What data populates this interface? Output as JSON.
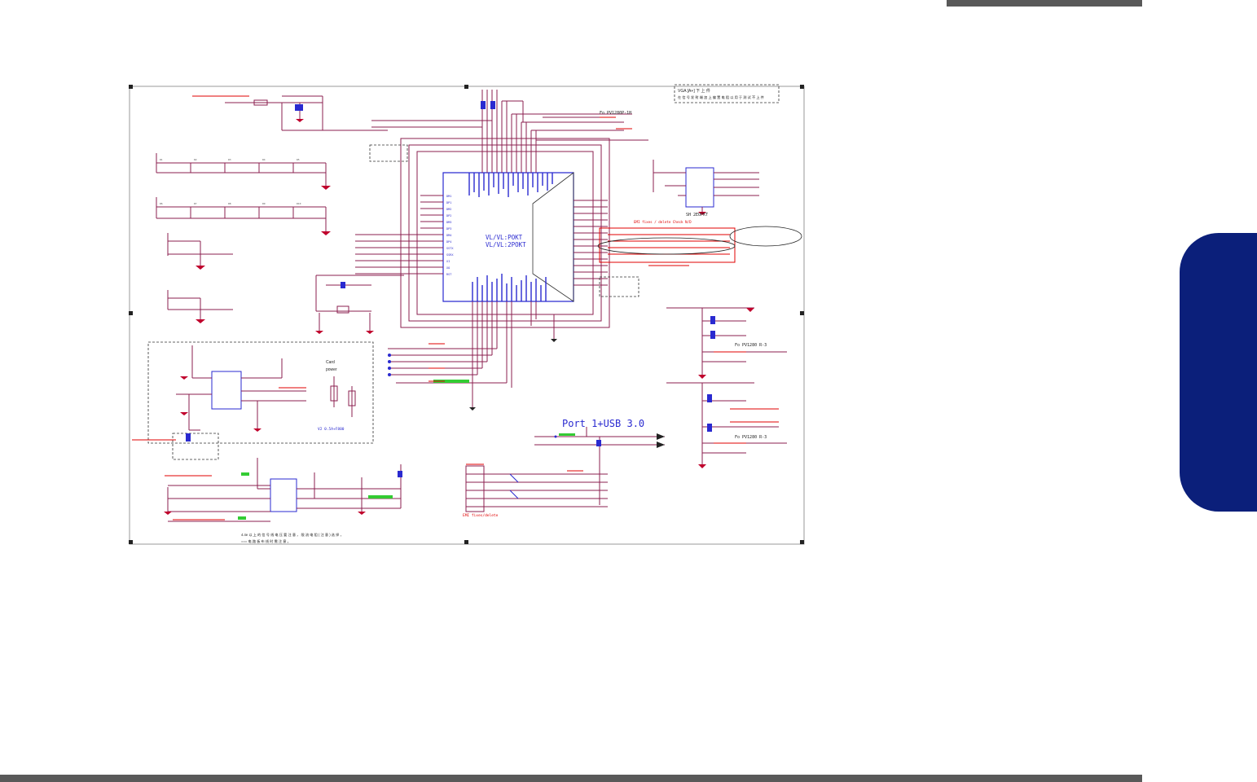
{
  "colors": {
    "page_background": "#ffffff",
    "header_bar": "#595959",
    "footer_bar": "#595959",
    "side_tab": "#0b1f7a",
    "wire": "#8b1f4f",
    "ic_outline": "#2a2ad0",
    "annotation": "#e00000",
    "label": "#222222"
  },
  "schematic": {
    "hub_chip_line1": "VL/VL:POKT",
    "hub_chip_line2": "VL/VL:2POKT",
    "connector_title": "Port 1+USB 3.0",
    "aux_chip_label": "SH 2EOPKT",
    "card_power_label_1": "Card",
    "card_power_label_2": "power",
    "note_top_right_1": "VGA [A+] 下 上 件",
    "note_top_right_2": "在 信 号 发 射 端 加 上 偏 置 电 阻 以 用 于 测 试 不 上 件",
    "note_bottom_1": "4.4e 以 上 的 信 号 线 电 压 要 注 意 ， 限 流 电 阻 ( 注 意 ) 选 择 ，",
    "note_bottom_2": "=== 电 路 板 布 线 时 需 注 意 。",
    "ref_hub_top": "Fo  PV1280P-1H",
    "ref_mid_right_1": "Fo  PV1280 R-3",
    "ref_mid_right_2": "Fo  PV1280 R-3",
    "rst_label": "V2 0.5A+F800",
    "annotation_header": "EMI  fixes  /  delete        Check N/D",
    "annotation_bottom": "EMI  fixes/delete"
  }
}
